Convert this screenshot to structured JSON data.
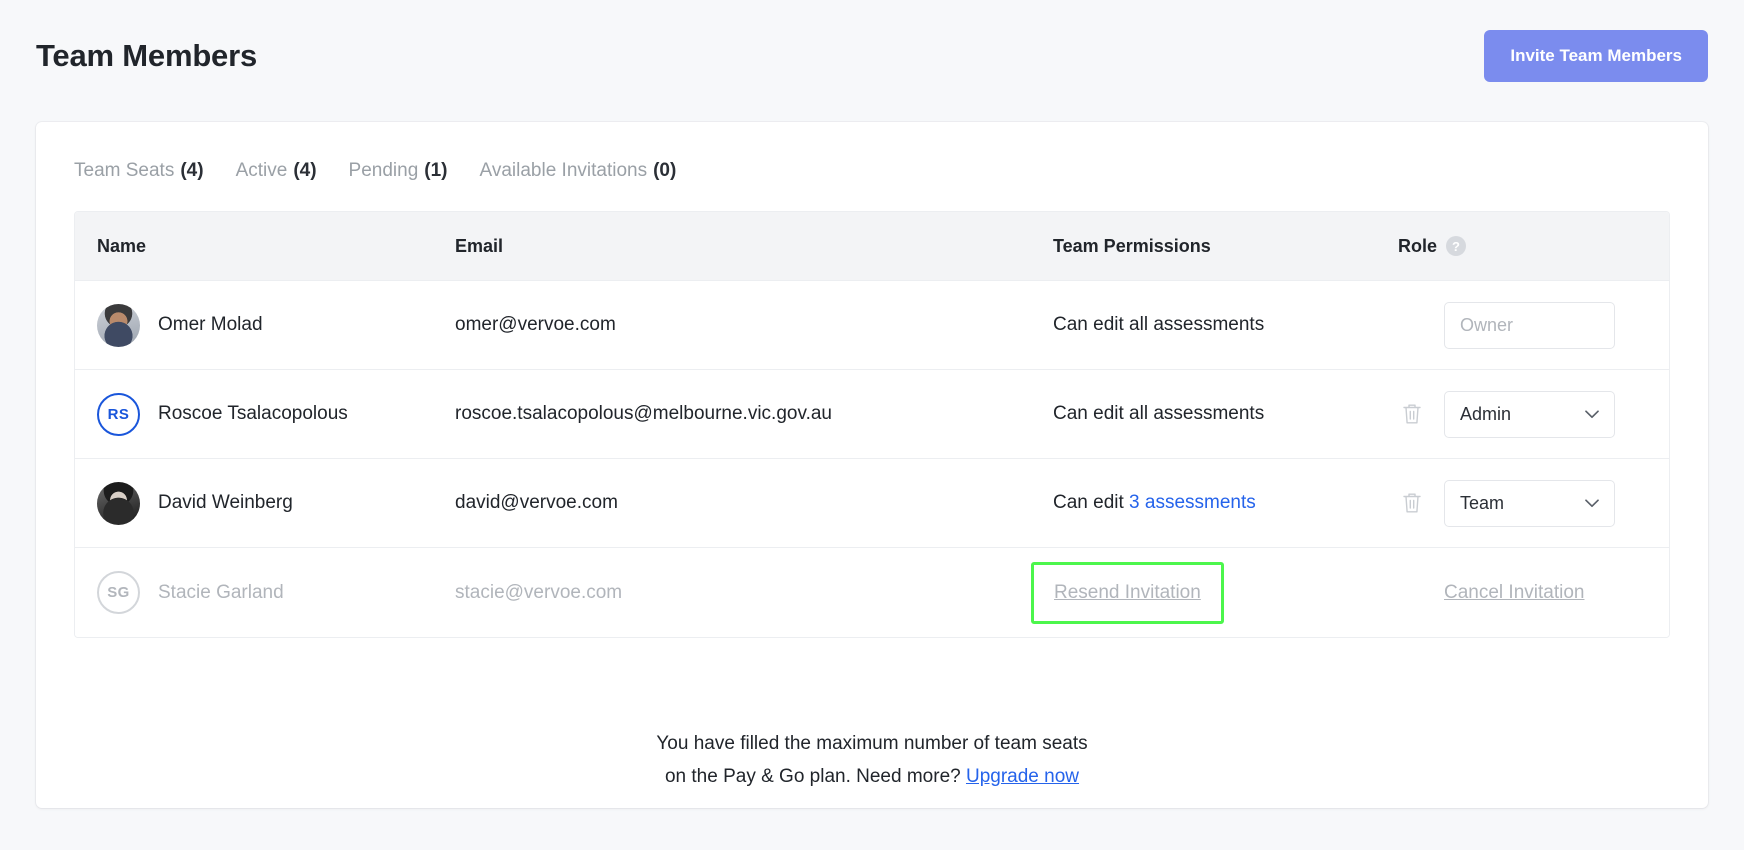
{
  "header": {
    "title": "Team Members",
    "invite_button": "Invite Team Members"
  },
  "tabs": [
    {
      "label": "Team Seats",
      "count": "(4)"
    },
    {
      "label": "Active",
      "count": "(4)"
    },
    {
      "label": "Pending",
      "count": "(1)"
    },
    {
      "label": "Available Invitations",
      "count": "(0)"
    }
  ],
  "table": {
    "columns": {
      "name": "Name",
      "email": "Email",
      "permissions": "Team Permissions",
      "role": "Role",
      "role_help": "?"
    },
    "rows": [
      {
        "name": "Omer Molad",
        "email": "omer@vervoe.com",
        "permission_prefix": "Can edit all assessments",
        "permission_link": "",
        "role": "Owner",
        "avatar_type": "photo-omer",
        "initials": "",
        "has_delete": false,
        "role_readonly": true,
        "pending": false
      },
      {
        "name": "Roscoe Tsalacopolous",
        "email": "roscoe.tsalacopolous@melbourne.vic.gov.au",
        "permission_prefix": "Can edit all assessments",
        "permission_link": "",
        "role": "Admin",
        "avatar_type": "initials-blue",
        "initials": "RS",
        "has_delete": true,
        "role_readonly": false,
        "pending": false
      },
      {
        "name": "David Weinberg",
        "email": "david@vervoe.com",
        "permission_prefix": "Can edit ",
        "permission_link": "3 assessments",
        "role": "Team",
        "avatar_type": "photo-david",
        "initials": "",
        "has_delete": true,
        "role_readonly": false,
        "pending": false
      },
      {
        "name": "Stacie Garland",
        "email": "stacie@vervoe.com",
        "permission_prefix": "",
        "permission_link": "",
        "resend_label": "Resend Invitation",
        "cancel_label": "Cancel Invitation",
        "avatar_type": "initials-grey",
        "initials": "SG",
        "has_delete": false,
        "role_readonly": false,
        "pending": true
      }
    ]
  },
  "footer": {
    "line1": "You have filled the maximum number of team seats",
    "line2": "on the Pay & Go plan. Need more?",
    "upgrade_link": "Upgrade now"
  },
  "colors": {
    "accent_button": "#7b8cee",
    "link_blue": "#2563eb",
    "highlight_green": "#4cf64c",
    "muted_text": "#b1b5bb",
    "page_bg": "#f7f8fa"
  }
}
